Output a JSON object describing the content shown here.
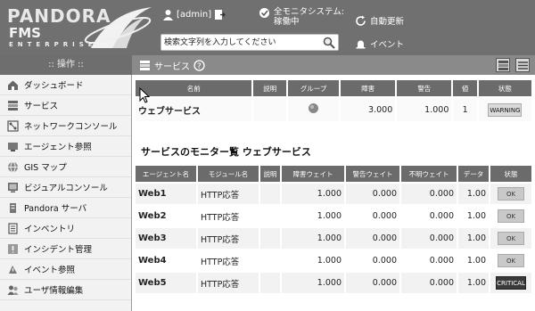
{
  "header": {
    "logo_line1": "PANDORA",
    "logo_line2": "FMS",
    "logo_line3": "ENTERPRISE",
    "user_label": "[admin]",
    "monitor_status_line1": "全モニタシステム:",
    "monitor_status_line2": "稼働中",
    "auto_refresh_label": "自動更新",
    "event_label": "イベント",
    "search_placeholder": "検索文字列を入力してください"
  },
  "sidebar": {
    "title": ":: 操作 ::",
    "items": [
      {
        "label": "ダッシュボード",
        "icon": "home-icon"
      },
      {
        "label": "サービス",
        "icon": "services-icon"
      },
      {
        "label": "ネットワークコンソール",
        "icon": "network-console-icon"
      },
      {
        "label": "エージェント参照",
        "icon": "agent-icon"
      },
      {
        "label": "GIS マップ",
        "icon": "globe-icon"
      },
      {
        "label": "ビジュアルコンソール",
        "icon": "visual-console-icon"
      },
      {
        "label": "Pandora サーバ",
        "icon": "server-icon"
      },
      {
        "label": "インベントリ",
        "icon": "inventory-icon"
      },
      {
        "label": "インシデント管理",
        "icon": "incident-icon"
      },
      {
        "label": "イベント参照",
        "icon": "event-icon"
      },
      {
        "label": "ユーザ情報編集",
        "icon": "user-edit-icon"
      }
    ]
  },
  "page": {
    "title": "サービス",
    "service_table": {
      "headers": [
        "名前",
        "説明",
        "グループ",
        "障害",
        "警告",
        "値",
        "状態"
      ],
      "rows": [
        {
          "name": "ウェブサービス",
          "description": "",
          "critical": "3.000",
          "warning": "1.000",
          "value": "1",
          "status": "WARNING"
        }
      ]
    },
    "monitor_section_title": "サービスのモニター覧 ウェブサービス",
    "monitor_table": {
      "headers": [
        "エージェント名",
        "モジュール名",
        "説明",
        "障害ウェイト",
        "警告ウェイト",
        "不明ウェイト",
        "データ",
        "状態"
      ],
      "rows": [
        {
          "agent": "Web1",
          "module": "HTTP応答",
          "desc": "",
          "crit_w": "1.000",
          "warn_w": "0.000",
          "unk_w": "0.000",
          "data": "1.00",
          "status": "OK"
        },
        {
          "agent": "Web2",
          "module": "HTTP応答",
          "desc": "",
          "crit_w": "1.000",
          "warn_w": "0.000",
          "unk_w": "0.000",
          "data": "1.00",
          "status": "OK"
        },
        {
          "agent": "Web3",
          "module": "HTTP応答",
          "desc": "",
          "crit_w": "1.000",
          "warn_w": "0.000",
          "unk_w": "0.000",
          "data": "1.00",
          "status": "OK"
        },
        {
          "agent": "Web4",
          "module": "HTTP応答",
          "desc": "",
          "crit_w": "1.000",
          "warn_w": "0.000",
          "unk_w": "0.000",
          "data": "1.00",
          "status": "OK"
        },
        {
          "agent": "Web5",
          "module": "HTTP応答",
          "desc": "",
          "crit_w": "1.000",
          "warn_w": "0.000",
          "unk_w": "0.000",
          "data": "1.00",
          "status": "CRITICAL"
        }
      ]
    }
  }
}
